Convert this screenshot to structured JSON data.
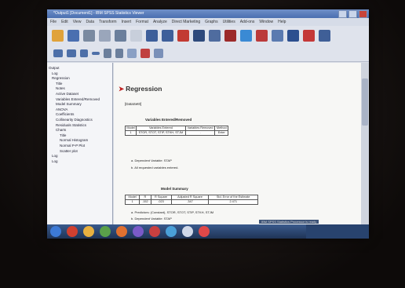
{
  "window": {
    "title": "*Output1 [Document1] - IBM SPSS Statistics Viewer"
  },
  "menu": [
    "File",
    "Edit",
    "View",
    "Data",
    "Transform",
    "Insert",
    "Format",
    "Analyze",
    "Direct Marketing",
    "Graphs",
    "Utilities",
    "Add-ons",
    "Window",
    "Help"
  ],
  "nav": {
    "items": [
      {
        "label": "Output",
        "level": 0
      },
      {
        "label": "Log",
        "level": 1
      },
      {
        "label": "Regression",
        "level": 1
      },
      {
        "label": "Title",
        "level": 2
      },
      {
        "label": "Notes",
        "level": 2
      },
      {
        "label": "Active Dataset",
        "level": 2
      },
      {
        "label": "Variables Entered/Removed",
        "level": 2
      },
      {
        "label": "Model Summary",
        "level": 2
      },
      {
        "label": "ANOVA",
        "level": 2
      },
      {
        "label": "Coefficients",
        "level": 2
      },
      {
        "label": "Collinearity Diagnostics",
        "level": 2
      },
      {
        "label": "Residuals Statistics",
        "level": 2
      },
      {
        "label": "Charts",
        "level": 2
      },
      {
        "label": "Title",
        "level": 3
      },
      {
        "label": "Normal Histogram",
        "level": 3
      },
      {
        "label": "Normal P-P Plot",
        "level": 3
      },
      {
        "label": "Scatter plot",
        "level": 3
      },
      {
        "label": "Log",
        "level": 1
      },
      {
        "label": "Log",
        "level": 1
      }
    ]
  },
  "content": {
    "heading": "Regression",
    "dataset": "[DataSet0]",
    "table1": {
      "caption": "Variables Entered/Removed",
      "headers": [
        "Model",
        "Variables Entered",
        "Variables Removed",
        "Method"
      ],
      "row": [
        "1",
        "STOR, STOT, STIP, STKH, STJM",
        ".",
        "Enter"
      ],
      "notes": [
        "a. Dependent Variable: STAP",
        "b. All requested variables entered."
      ]
    },
    "table2": {
      "caption": "Model Summary",
      "headers": [
        "Model",
        "R",
        "R Square",
        "Adjusted R Square",
        "Std. Error of the Estimate"
      ],
      "row": [
        "1",
        ".152",
        ".023",
        ".347",
        "2.471"
      ],
      "notes": [
        "a. Predictors: (Constant), STOR, STOT, STIP, STKH, STJM",
        "b. Dependent Variable: STAP"
      ]
    }
  },
  "status": "IBM SPSS Statistics Processor is ready"
}
